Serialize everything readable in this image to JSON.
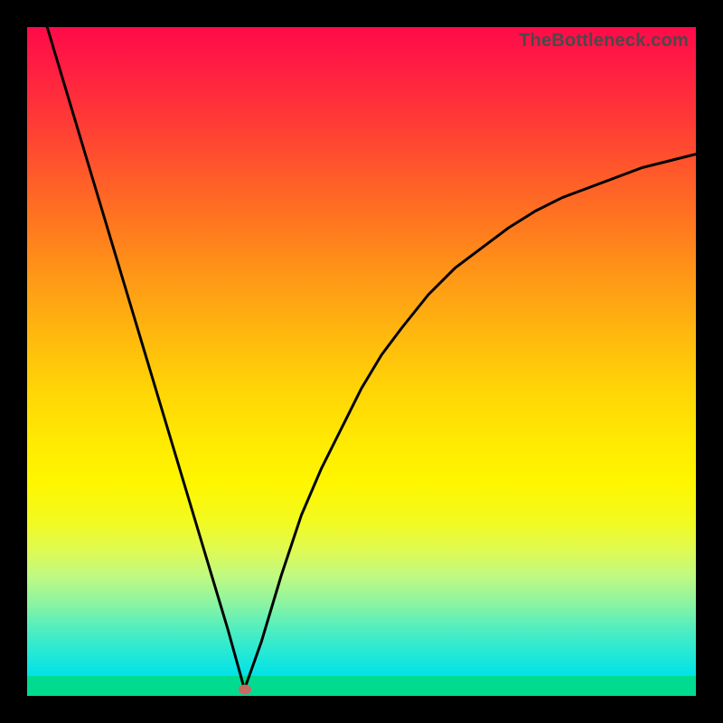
{
  "watermark": "TheBottleneck.com",
  "colors": {
    "black": "#000000",
    "curve": "#000000",
    "marker": "#c96a60",
    "band_green": "#00db90"
  },
  "chart_data": {
    "type": "line",
    "title": "",
    "xlabel": "",
    "ylabel": "",
    "xlim": [
      0,
      100
    ],
    "ylim": [
      0,
      100
    ],
    "annotations": [],
    "marker": {
      "x": 32.5,
      "y": 1
    },
    "series": [
      {
        "name": "bottleneck-curve",
        "x": [
          3,
          6,
          9,
          12,
          15,
          18,
          21,
          24,
          27,
          30,
          32.5,
          35,
          38,
          41,
          44,
          47,
          50,
          53,
          56,
          60,
          64,
          68,
          72,
          76,
          80,
          84,
          88,
          92,
          96,
          100
        ],
        "y": [
          100,
          90,
          80,
          70,
          60,
          50,
          40,
          30,
          20,
          10,
          1,
          8,
          18,
          27,
          34,
          40,
          46,
          51,
          55,
          60,
          64,
          67,
          70,
          72.5,
          74.5,
          76,
          77.5,
          79,
          80,
          81
        ]
      }
    ]
  }
}
